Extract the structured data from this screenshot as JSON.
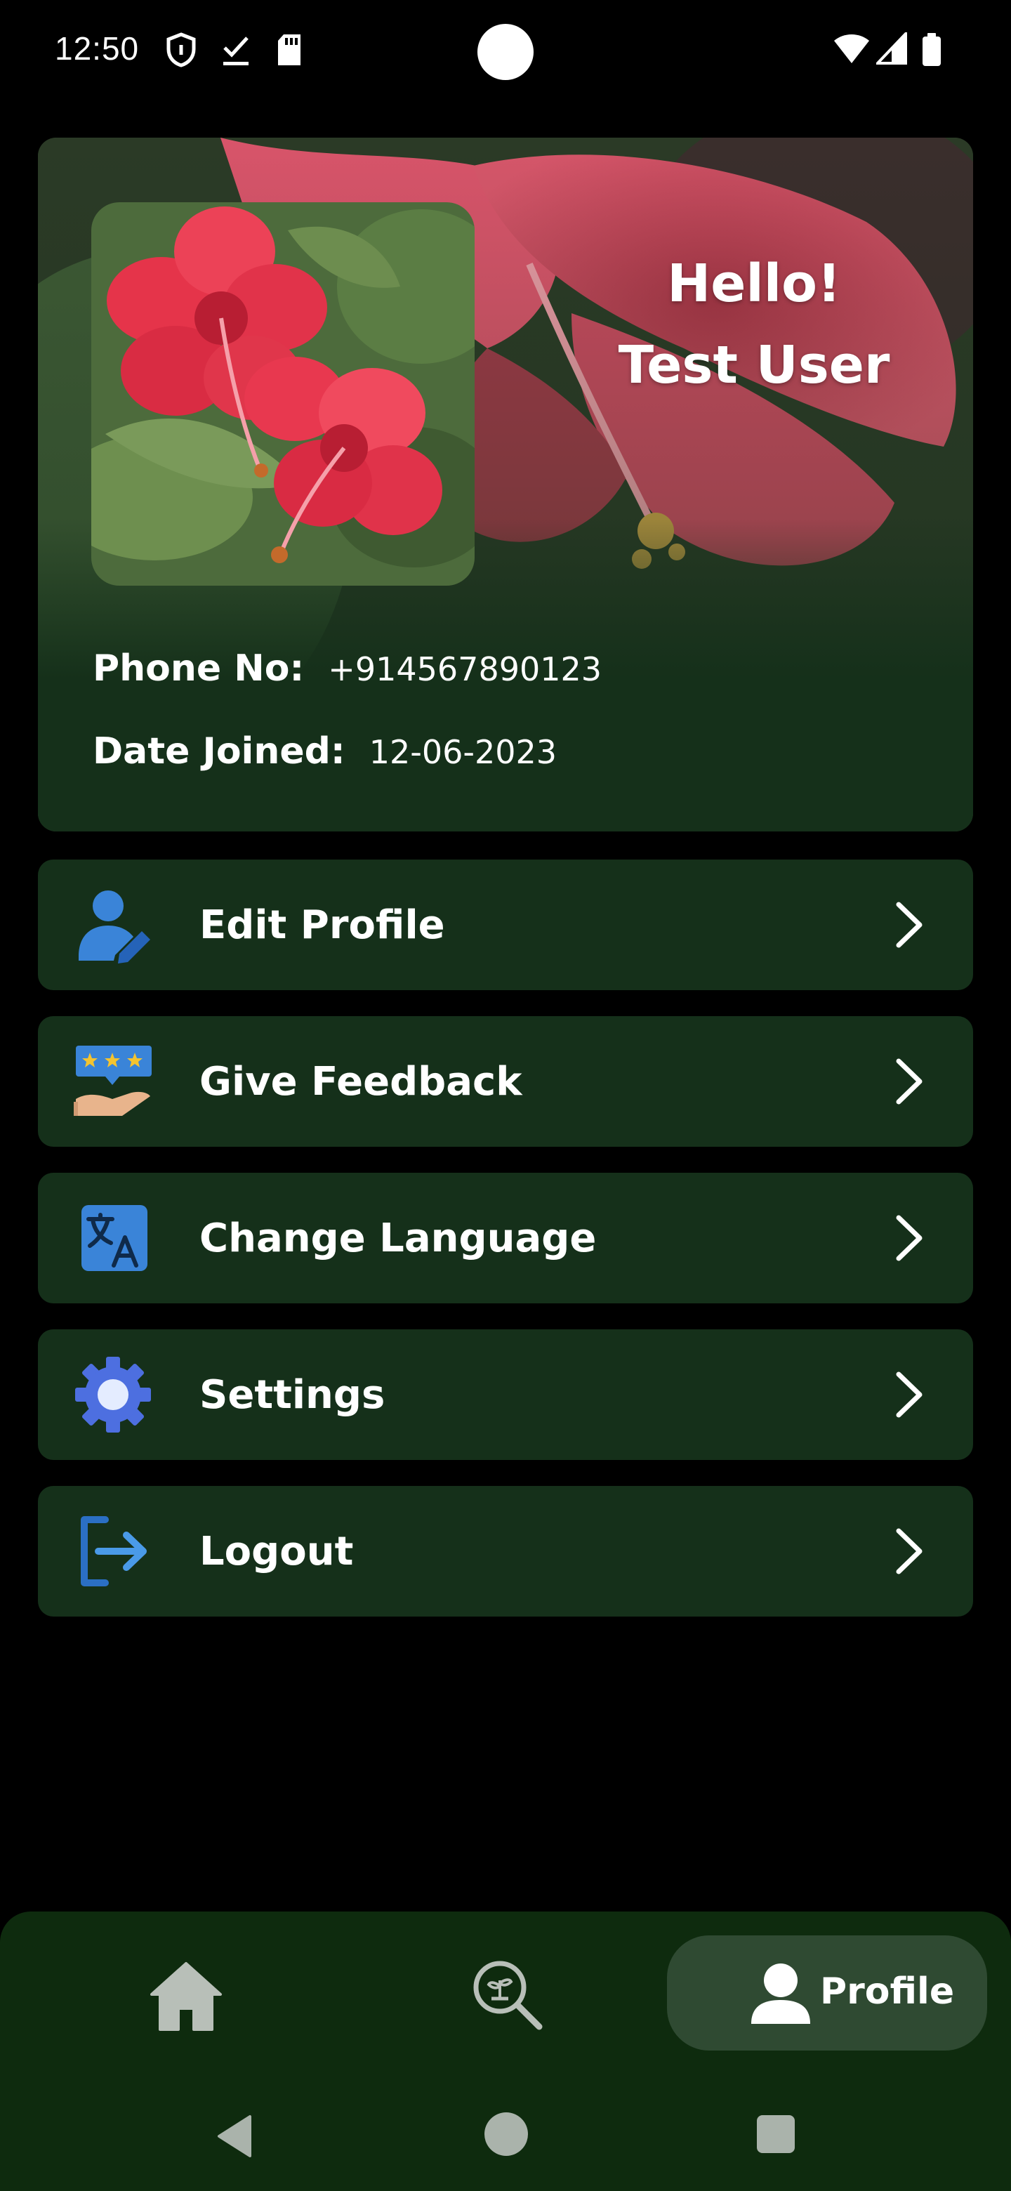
{
  "status_bar": {
    "time": "12:50"
  },
  "profile": {
    "greeting_line1": "Hello!",
    "greeting_line2": "Test User",
    "phone_label": "Phone No:",
    "phone_value": "+914567890123",
    "joined_label": "Date Joined:",
    "joined_value": "12-06-2023"
  },
  "menu": {
    "items": [
      {
        "label": "Edit Profile",
        "icon": "edit-profile-icon"
      },
      {
        "label": "Give Feedback",
        "icon": "feedback-icon"
      },
      {
        "label": "Change Language",
        "icon": "translate-icon"
      },
      {
        "label": "Settings",
        "icon": "gear-icon"
      },
      {
        "label": "Logout",
        "icon": "logout-icon"
      }
    ]
  },
  "bottom_nav": {
    "active_label": "Profile",
    "items": [
      "home-icon",
      "plant-search-icon",
      "profile-icon"
    ]
  },
  "colors": {
    "card_bg": "#15301a",
    "nav_bg": "#0e2b0e",
    "active_pill": "#2f4a32",
    "accent_blue": "#3a7bd5",
    "flower_red": "#e8384f"
  }
}
